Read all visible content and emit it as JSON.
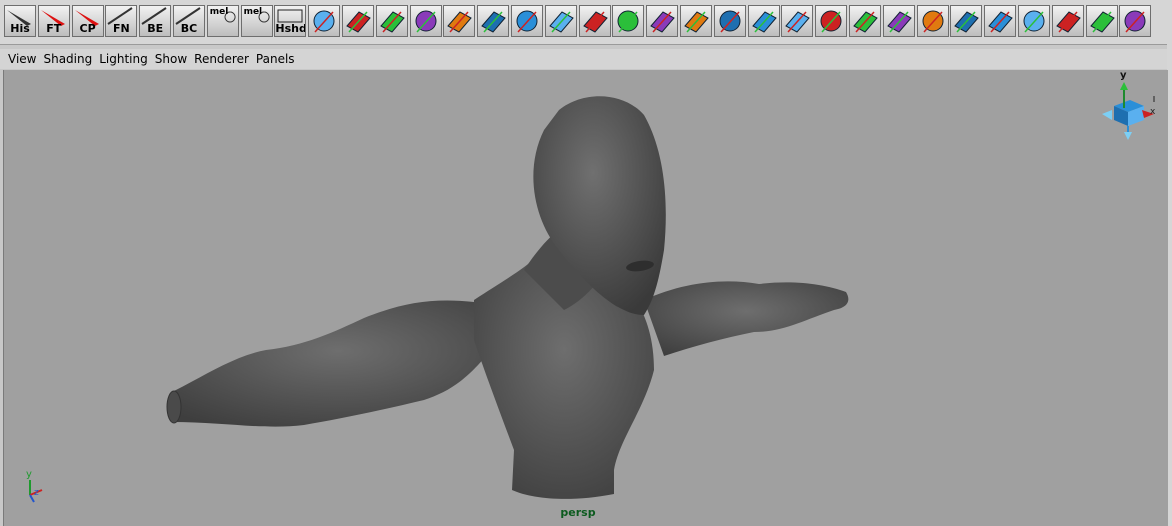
{
  "shelf": {
    "buttons": [
      {
        "label": "His",
        "icon": "history-icon"
      },
      {
        "label": "FT",
        "icon": "freeze-transform-icon"
      },
      {
        "label": "CP",
        "icon": "center-pivot-icon"
      },
      {
        "label": "FN",
        "icon": "face-normals-icon"
      },
      {
        "label": "BE",
        "icon": "border-edges-icon"
      },
      {
        "label": "BC",
        "icon": "backface-culling-icon"
      },
      {
        "label": "mel",
        "icon": "mel-script-icon"
      },
      {
        "label": "mel",
        "icon": "mel-script-icon"
      },
      {
        "label": "Hshd",
        "icon": "hide-shading-icon"
      },
      {
        "label": "",
        "icon": "curve-tool-icon"
      },
      {
        "label": "",
        "icon": "cut-curve-icon"
      },
      {
        "label": "",
        "icon": "cv-curve-icon"
      },
      {
        "label": "",
        "icon": "ep-curve-icon"
      },
      {
        "label": "",
        "icon": "loft-icon"
      },
      {
        "label": "",
        "icon": "revolve-icon"
      },
      {
        "label": "",
        "icon": "planar-surface-icon"
      },
      {
        "label": "",
        "icon": "extrude-surface-icon"
      },
      {
        "label": "",
        "icon": "surface-patch-icon"
      },
      {
        "label": "",
        "icon": "boolean-icon"
      },
      {
        "label": "",
        "icon": "trim-tool-icon"
      },
      {
        "label": "",
        "icon": "bevel-icon"
      },
      {
        "label": "",
        "icon": "attach-surfaces-icon"
      },
      {
        "label": "",
        "icon": "rebuild-surface-icon"
      },
      {
        "label": "",
        "icon": "insert-isoparm-icon"
      },
      {
        "label": "",
        "icon": "lattice-icon"
      },
      {
        "label": "",
        "icon": "soft-mod-icon"
      },
      {
        "label": "",
        "icon": "sculpt-sphere-icon"
      },
      {
        "label": "",
        "icon": "nurbs-sphere-deform-icon"
      },
      {
        "label": "",
        "icon": "sphere-split-icon"
      },
      {
        "label": "",
        "icon": "surface-pieces-icon"
      },
      {
        "label": "",
        "icon": "duplicate-surface-icon"
      },
      {
        "label": "",
        "icon": "nurbs-sphere-icon"
      },
      {
        "label": "",
        "icon": "nurbs-cylinder-icon"
      },
      {
        "label": "",
        "icon": "nurbs-plane-icon"
      }
    ]
  },
  "menu": {
    "items": [
      "View",
      "Shading",
      "Lighting",
      "Show",
      "Renderer",
      "Panels"
    ]
  },
  "viewport": {
    "camera_label": "persp",
    "axis_labels": {
      "y": "y",
      "x": "x",
      "z": "z"
    },
    "colors": {
      "background": "#a0a0a0",
      "model": "#5c5c5c",
      "camera_label": "#0b5a1e"
    }
  }
}
